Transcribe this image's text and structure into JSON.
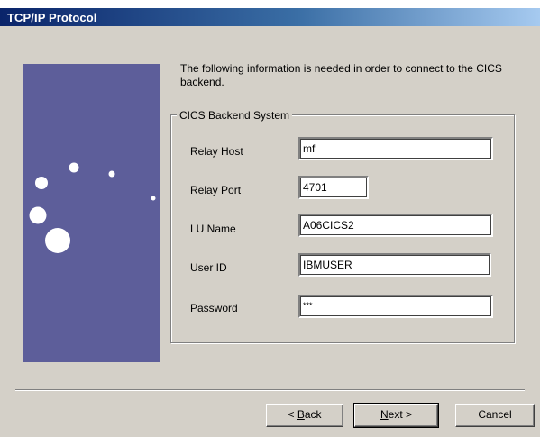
{
  "window": {
    "title": "TCP/IP Protocol"
  },
  "intro": {
    "text": "The following information is needed in order to connect to the CICS backend."
  },
  "group": {
    "legend": "CICS Backend System"
  },
  "fields": {
    "relay_host": {
      "label": "Relay Host",
      "value": "mf"
    },
    "relay_port": {
      "label": "Relay Port",
      "value": "4701"
    },
    "lu_name": {
      "label": "LU Name",
      "value": "A06CICS2"
    },
    "user_id": {
      "label": "User ID",
      "value": "IBMUSER"
    },
    "password": {
      "label": "Password",
      "value": "***"
    }
  },
  "buttons": {
    "back_prefix": "< ",
    "back_mnemonic": "B",
    "back_rest": "ack",
    "next_mnemonic": "N",
    "next_rest": "ext >",
    "cancel": "Cancel"
  },
  "colors": {
    "titlebar": "#0a246a",
    "side_panel": "#5d5e9a",
    "dialog_face": "#d4d0c8"
  }
}
